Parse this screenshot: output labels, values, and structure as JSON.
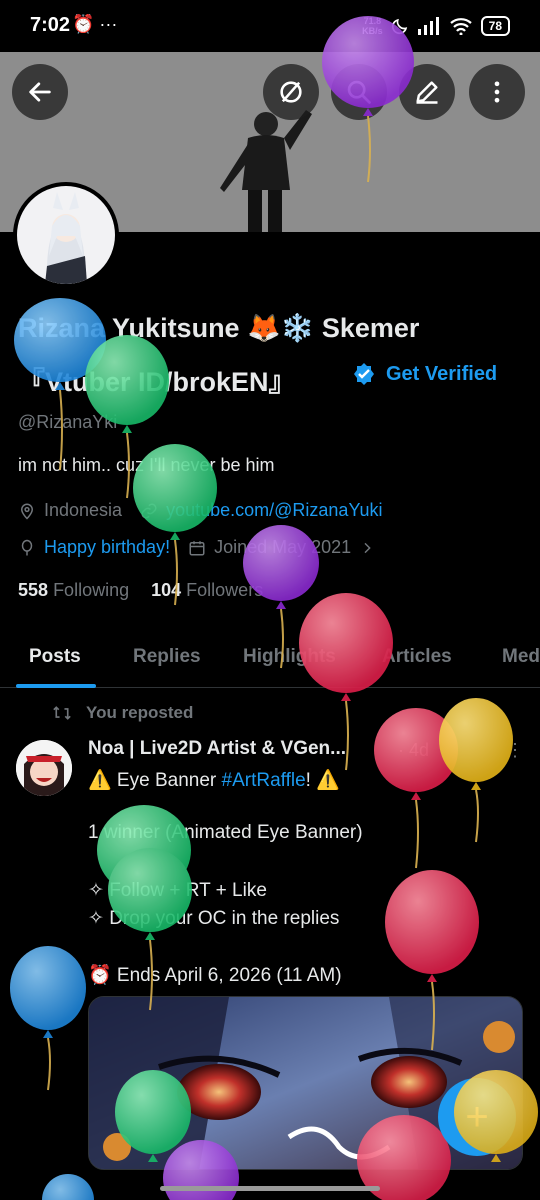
{
  "status_bar": {
    "time": "7:02",
    "left_icons": "⏰ ···",
    "net_speed_value": "71.8",
    "net_speed_unit": "KB/s",
    "battery": "78"
  },
  "profile": {
    "name_line1": "Rizana Yukitsune 🦊❄️ Skemer",
    "name_line2": "『Vtuber ID/brokEN』",
    "get_verified": "Get Verified",
    "handle": "@RizanaYki",
    "bio": "im not him.. cuz I'll never be him",
    "location": "Indonesia",
    "website": "youtube.com/@RizanaYuki",
    "birthday": "Happy birthday!",
    "joined": "Joined May 2021",
    "following_count": "558",
    "following_label": "Following",
    "followers_count": "104",
    "followers_label": "Followers"
  },
  "tabs": [
    "Posts",
    "Replies",
    "Highlights",
    "Articles",
    "Media"
  ],
  "post": {
    "repost_label": "You reposted",
    "author": "Noa | Live2D Artist & VGen...",
    "time": "· 4d",
    "more": "⋮",
    "line1_prefix": "⚠️ Eye Banner ",
    "line1_tag": "#ArtRaffle",
    "line1_suffix": "! ⚠️",
    "line2": "1 winner (Animated Eye Banner)",
    "line3": "✧ Follow + RT + Like",
    "line4": "✧ Drop your OC in the replies",
    "line5": "⏰ Ends April 6, 2026 (11 AM)"
  },
  "fab_label": "+",
  "colors": {
    "accent": "#1d9bf0",
    "background": "#000000",
    "text": "#e7e9ea",
    "muted": "#71767b"
  },
  "icons": [
    "back-arrow-icon",
    "grok-icon",
    "search-icon",
    "edit-pencil-icon",
    "more-vertical-icon",
    "location-pin-icon",
    "link-icon",
    "balloon-icon",
    "calendar-icon",
    "chevron-right-icon",
    "repost-icon",
    "verified-badge-icon"
  ]
}
